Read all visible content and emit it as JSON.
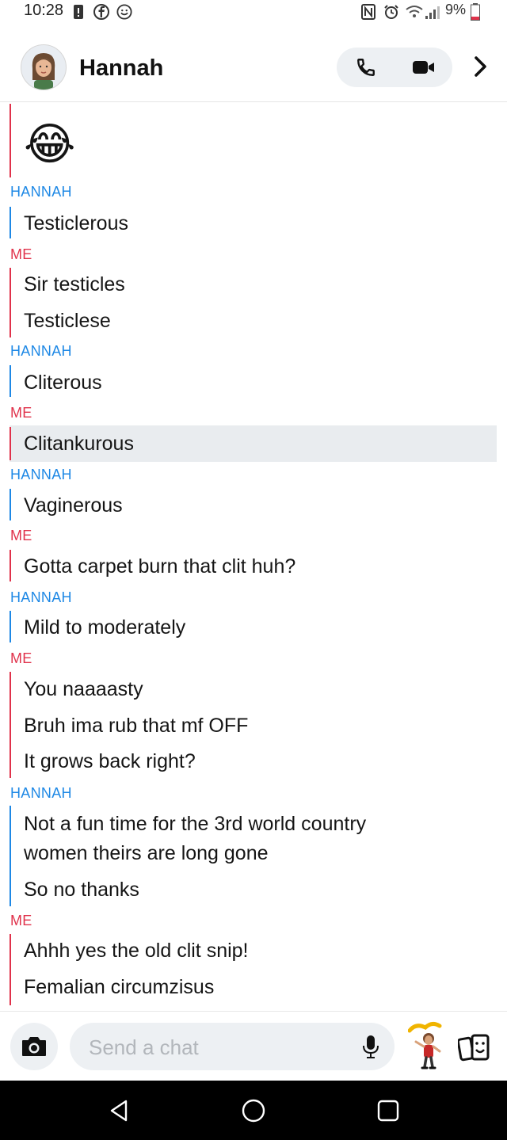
{
  "status_bar": {
    "time": "10:28",
    "battery": "9%"
  },
  "header": {
    "contact_name": "Hannah"
  },
  "messages": [
    {
      "sender": "",
      "lines": [
        "😂"
      ]
    },
    {
      "sender": "HANNAH",
      "lines": [
        "Testiclerous"
      ]
    },
    {
      "sender": "ME",
      "lines": [
        "Sir testicles",
        "Testiclese"
      ]
    },
    {
      "sender": "HANNAH",
      "lines": [
        "Cliterous"
      ]
    },
    {
      "sender": "ME",
      "lines": [
        "Clitankurous"
      ]
    },
    {
      "sender": "HANNAH",
      "lines": [
        "Vaginerous"
      ]
    },
    {
      "sender": "ME",
      "lines": [
        "Gotta carpet burn that clit huh?"
      ]
    },
    {
      "sender": "HANNAH",
      "lines": [
        "Mild to moderately"
      ]
    },
    {
      "sender": "ME",
      "lines": [
        "You naaaasty",
        "Bruh ima rub that mf OFF",
        "It grows back right?"
      ]
    },
    {
      "sender": "HANNAH",
      "lines": [
        "Not a fun time for the 3rd world country",
        "women theirs are long gone",
        "So no thanks"
      ]
    },
    {
      "sender": "ME",
      "lines": [
        "Ahhh yes the old clit snip!",
        "Femalian circumzisus"
      ]
    }
  ],
  "input": {
    "placeholder": "Send a chat"
  },
  "colors": {
    "me": "#e0324b",
    "hannah": "#1e88e5",
    "highlight": "#e9ecef"
  },
  "icons": {
    "header": [
      "avatar",
      "phone-icon",
      "video-camera-icon",
      "chevron-right-icon"
    ],
    "input": [
      "camera-icon",
      "microphone-icon",
      "bitmoji-sticker-icon",
      "cards-icon"
    ],
    "nav": [
      "back-triangle-icon",
      "home-circle-icon",
      "recents-square-icon"
    ]
  }
}
